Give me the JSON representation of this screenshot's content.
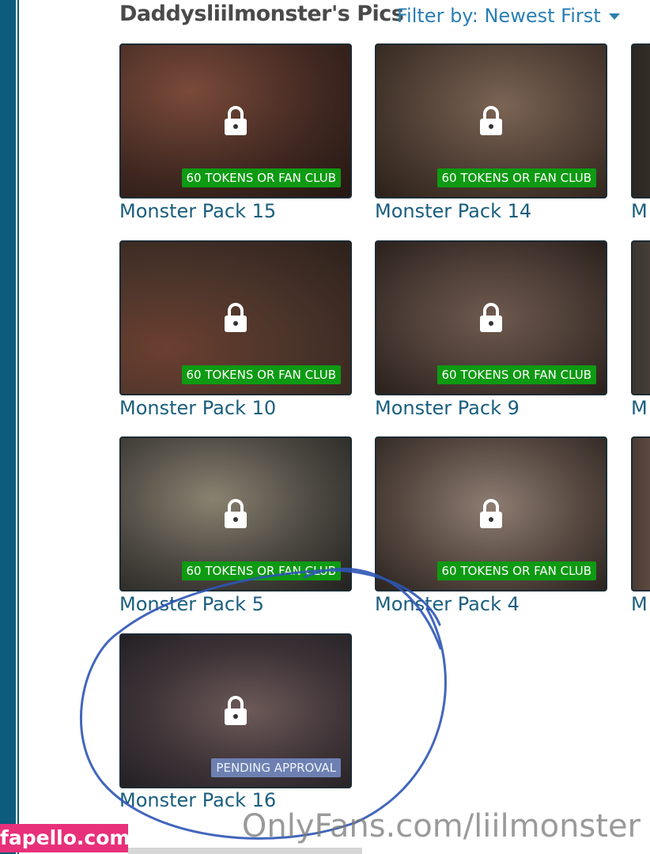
{
  "header": {
    "title": "Daddysliilmonster's Pics",
    "filter_label": "Filter by: Newest First"
  },
  "gallery": {
    "items": [
      {
        "title": "Monster Pack 15",
        "badge": "60 TOKENS OR FAN CLUB",
        "status": "locked"
      },
      {
        "title": "Monster Pack 14",
        "badge": "60 TOKENS OR FAN CLUB",
        "status": "locked"
      },
      {
        "title": "M",
        "status": "locked"
      },
      {
        "title": "Monster Pack 10",
        "badge": "60 TOKENS OR FAN CLUB",
        "status": "locked"
      },
      {
        "title": "Monster Pack 9",
        "badge": "60 TOKENS OR FAN CLUB",
        "status": "locked"
      },
      {
        "title": "M",
        "status": "locked"
      },
      {
        "title": "Monster Pack 5",
        "badge": "60 TOKENS OR FAN CLUB",
        "status": "locked"
      },
      {
        "title": "Monster Pack 4",
        "badge": "60 TOKENS OR FAN CLUB",
        "status": "locked"
      },
      {
        "title": "M",
        "status": "locked"
      },
      {
        "title": "Monster Pack 16",
        "badge": "PENDING APPROVAL",
        "status": "pending"
      }
    ]
  },
  "overlays": {
    "watermark": "OnlyFans.com/liilmonster",
    "site_tag": "fapello.com",
    "annotation": "blue-circle-marker"
  },
  "colors": {
    "sidebar": "#0d5b7d",
    "link": "#1a5e7e",
    "filter": "#2a7fb3",
    "badge_locked": "#0e9a12",
    "badge_pending": "#6d80b2",
    "site_tag": "#e8307a",
    "annotation": "#2e55b5"
  },
  "icons": [
    "lock-icon",
    "caret-down-icon"
  ]
}
